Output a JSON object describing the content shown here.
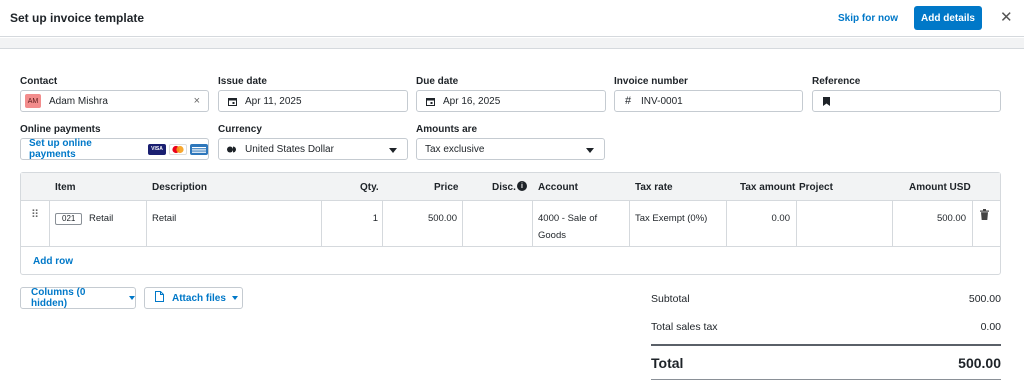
{
  "header": {
    "title": "Set up invoice template",
    "skip_label": "Skip for now",
    "add_label": "Add details",
    "close_glyph": "✕"
  },
  "form": {
    "contact": {
      "label": "Contact",
      "initials": "AM",
      "value": "Adam Mishra",
      "clear_glyph": "×"
    },
    "issue_date": {
      "label": "Issue date",
      "value": "Apr 11, 2025"
    },
    "due_date": {
      "label": "Due date",
      "value": "Apr 16, 2025"
    },
    "invoice_number": {
      "label": "Invoice number",
      "prefix": "#",
      "value": "INV-0001"
    },
    "reference": {
      "label": "Reference",
      "value": ""
    },
    "online_payments": {
      "label": "Online payments",
      "link": "Set up online payments",
      "cards": [
        "visa-icon",
        "mastercard-icon",
        "amex-icon"
      ]
    },
    "currency": {
      "label": "Currency",
      "value": "United States Dollar"
    },
    "amounts_are": {
      "label": "Amounts are",
      "value": "Tax exclusive"
    }
  },
  "table": {
    "headers": [
      "Item",
      "Description",
      "Qty.",
      "Price",
      "Disc.",
      "Account",
      "Tax rate",
      "Tax amount",
      "Project",
      "Amount USD"
    ],
    "rows": [
      {
        "item_code": "021",
        "item_name": "Retail",
        "description": "Retail",
        "qty": "1",
        "price": "500.00",
        "disc": "",
        "account_line1": "4000 - Sale of",
        "account_line2": "Goods",
        "tax_rate": "Tax Exempt (0%)",
        "tax_amount": "0.00",
        "project": "",
        "amount": "500.00"
      }
    ],
    "add_row_label": "Add row"
  },
  "actions": {
    "columns_label": "Columns (0 hidden)",
    "attach_label": "Attach files"
  },
  "totals": {
    "subtotal_label": "Subtotal",
    "subtotal_value": "500.00",
    "tax_label": "Total sales tax",
    "tax_value": "0.00",
    "total_label": "Total",
    "total_value": "500.00"
  },
  "colors": {
    "accent": "#0078c8",
    "header_bg": "#f2f3f4",
    "border": "#d5d9dd",
    "avatar_bg": "#f28c8c"
  }
}
